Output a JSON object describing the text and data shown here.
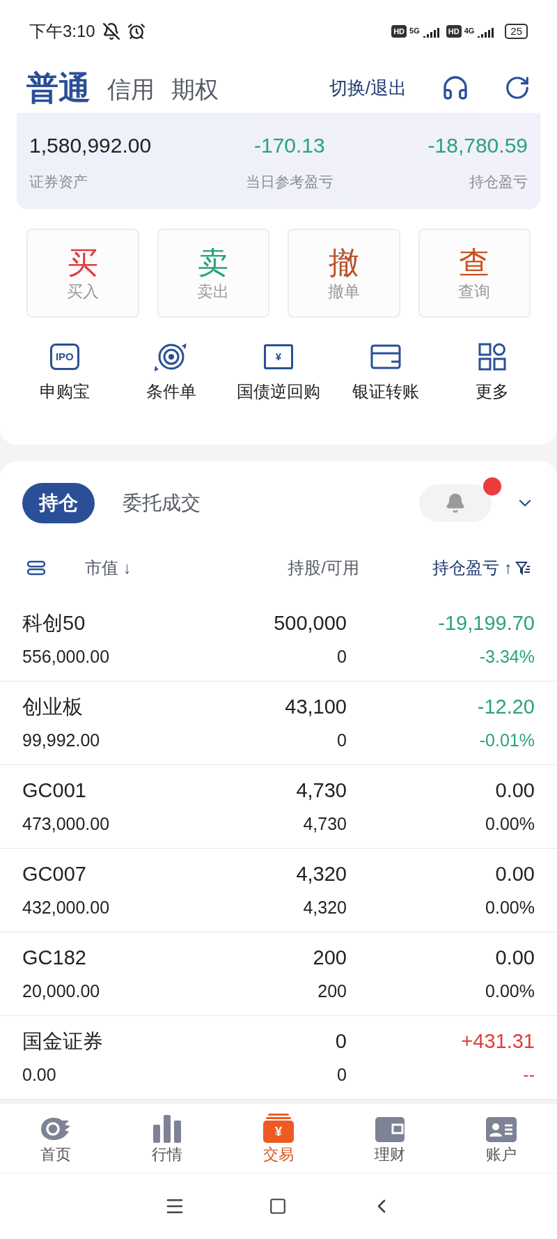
{
  "status_bar": {
    "time": "下午3:10",
    "networks": [
      {
        "badge": "HD",
        "type": "5G"
      },
      {
        "badge": "HD",
        "type": "4G"
      }
    ],
    "battery": "25"
  },
  "account_tabs": [
    {
      "label": "普通",
      "selected": true
    },
    {
      "label": "信用",
      "selected": false
    },
    {
      "label": "期权",
      "selected": false
    }
  ],
  "switch_link": "切换/退出",
  "summary": [
    {
      "value": "1,580,992.00",
      "label": "证券资产",
      "color": "#222222"
    },
    {
      "value": "-170.13",
      "label": "当日参考盈亏",
      "color": "#2aa37a"
    },
    {
      "value": "-18,780.59",
      "label": "持仓盈亏",
      "color": "#2aa37a"
    }
  ],
  "trade_buttons": [
    {
      "glyph": "买",
      "label": "买入",
      "color": "#e03c3c"
    },
    {
      "glyph": "卖",
      "label": "卖出",
      "color": "#2aa37a"
    },
    {
      "glyph": "撤",
      "label": "撤单",
      "color": "#b5532a"
    },
    {
      "glyph": "查",
      "label": "查询",
      "color": "#c4541f"
    }
  ],
  "shortcuts": [
    {
      "kind": "ipo",
      "icon_text": "IPO",
      "label": "申购宝"
    },
    {
      "kind": "target",
      "label": "条件单"
    },
    {
      "kind": "repo",
      "icon_text": "¥",
      "label": "国债逆回购"
    },
    {
      "kind": "card",
      "label": "银证转账"
    },
    {
      "kind": "grid",
      "label": "更多"
    }
  ],
  "holding_tabs": [
    {
      "label": "持仓",
      "selected": true
    },
    {
      "label": "委托成交",
      "selected": false
    }
  ],
  "alert": {
    "unread": true
  },
  "columns": [
    {
      "label": "市值",
      "sort_arrow": "↓"
    },
    {
      "label": "持股/可用"
    },
    {
      "label": "持仓盈亏",
      "sort_arrow": "↑"
    }
  ],
  "rows": [
    {
      "name": "科创50",
      "market_value": "556,000.00",
      "shares": "500,000",
      "available": "0",
      "pnl": "-19,199.70",
      "pnl_pct": "-3.34%",
      "color": "#2aa37a"
    },
    {
      "name": "创业板",
      "market_value": "99,992.00",
      "shares": "43,100",
      "available": "0",
      "pnl": "-12.20",
      "pnl_pct": "-0.01%",
      "color": "#2aa37a"
    },
    {
      "name": "GC001",
      "market_value": "473,000.00",
      "shares": "4,730",
      "available": "4,730",
      "pnl": "0.00",
      "pnl_pct": "0.00%",
      "color": "#222222"
    },
    {
      "name": "GC007",
      "market_value": "432,000.00",
      "shares": "4,320",
      "available": "4,320",
      "pnl": "0.00",
      "pnl_pct": "0.00%",
      "color": "#222222"
    },
    {
      "name": "GC182",
      "market_value": "20,000.00",
      "shares": "200",
      "available": "200",
      "pnl": "0.00",
      "pnl_pct": "0.00%",
      "color": "#222222"
    },
    {
      "name": "国金证券",
      "market_value": "0.00",
      "shares": "0",
      "available": "0",
      "pnl": "+431.31",
      "pnl_pct": "--",
      "color": "#e03c3c"
    }
  ],
  "bottom_nav": [
    {
      "kind": "home",
      "label": "首页",
      "selected": false
    },
    {
      "kind": "market",
      "label": "行情",
      "selected": false
    },
    {
      "kind": "trade",
      "icon_text": "¥",
      "label": "交易",
      "selected": true
    },
    {
      "kind": "wealth",
      "label": "理财",
      "selected": false
    },
    {
      "kind": "account",
      "label": "账户",
      "selected": false
    }
  ]
}
